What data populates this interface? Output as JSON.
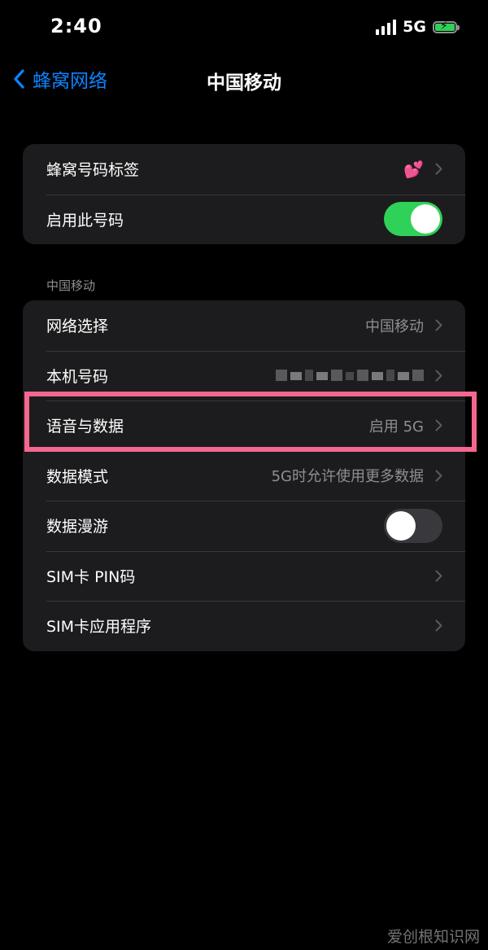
{
  "status_bar": {
    "time": "2:40",
    "network": "5G",
    "signal_icon": "cellular-signal-icon",
    "battery_icon": "battery-charging-icon",
    "battery_color": "#30d158"
  },
  "nav": {
    "back_label": "蜂窝网络",
    "title": "中国移动",
    "back_icon": "chevron-left-icon",
    "accent_color": "#0a84ff"
  },
  "group1": {
    "rows": [
      {
        "label": "蜂窝号码标签",
        "value": "💕"
      },
      {
        "label": "启用此号码",
        "toggle": true
      }
    ]
  },
  "section_header": "中国移动",
  "group2": {
    "rows": [
      {
        "label": "网络选择",
        "value": "中国移动"
      },
      {
        "label": "本机号码",
        "value": ""
      },
      {
        "label": "语音与数据",
        "value": "启用 5G"
      },
      {
        "label": "数据模式",
        "value": "5G时允许使用更多数据"
      },
      {
        "label": "数据漫游",
        "toggle": false
      },
      {
        "label": "SIM卡 PIN码",
        "value": ""
      },
      {
        "label": "SIM卡应用程序",
        "value": ""
      }
    ]
  },
  "highlight_color": "#f4678f",
  "watermark": "爱创根知识网"
}
